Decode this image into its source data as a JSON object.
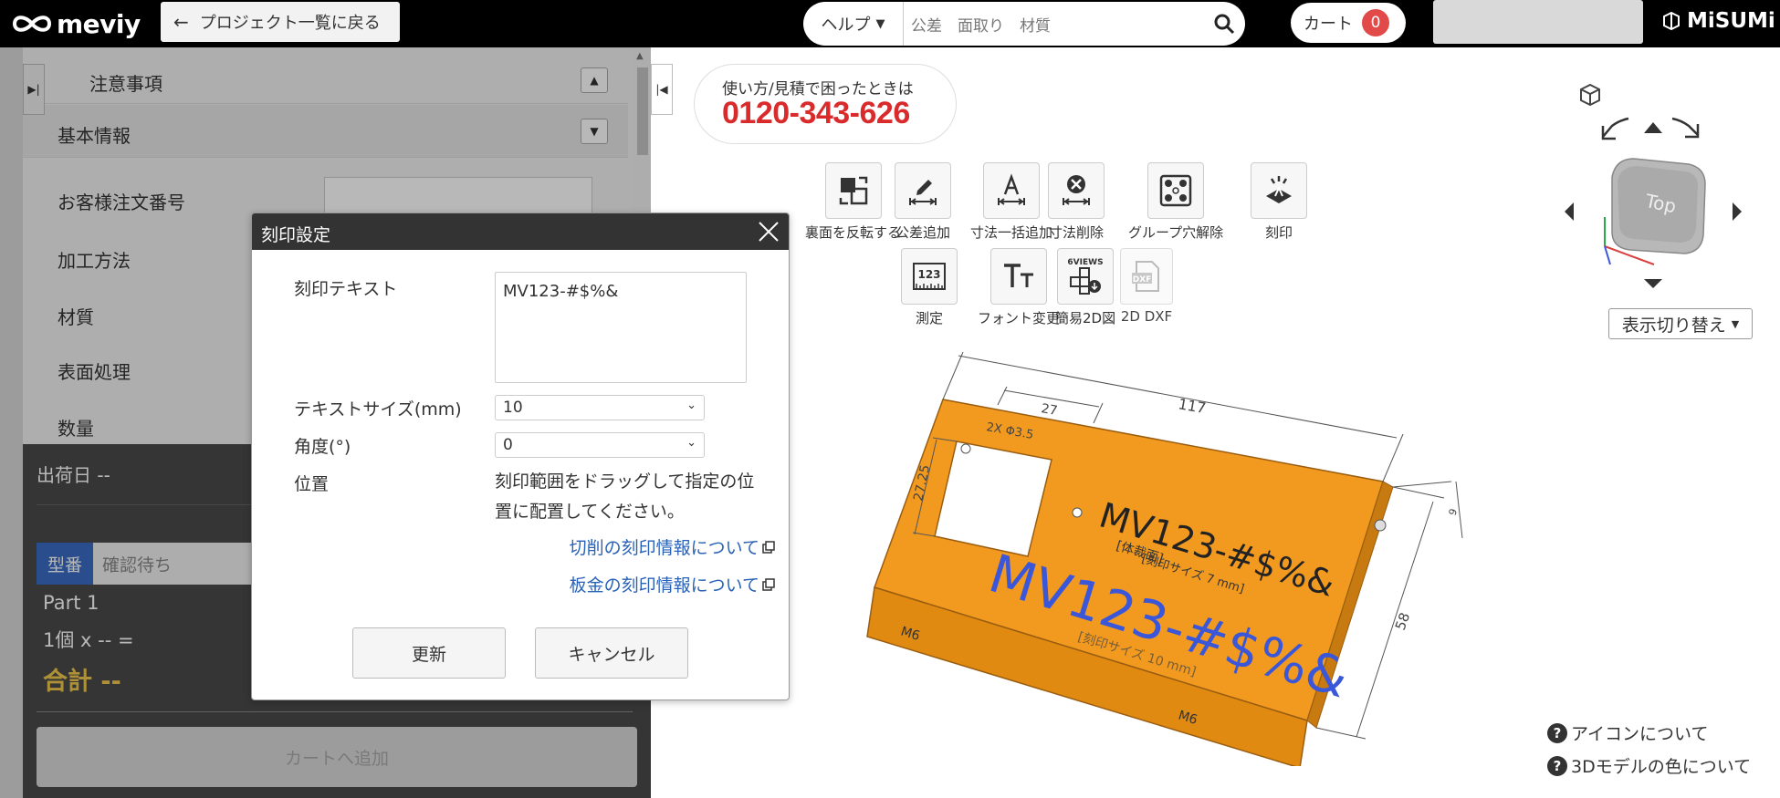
{
  "header": {
    "logo_text": "meviy",
    "back_label": "プロジェクト一覧に戻る",
    "help_label": "ヘルプ",
    "search_placeholder": "公差　面取り　材質",
    "cart_label": "カート",
    "cart_count": "0",
    "brand": "MiSUMi"
  },
  "left_panel": {
    "notes_label": "注意事項",
    "basic_info_label": "基本情報",
    "fields": [
      "お客様注文番号",
      "加工方法",
      "材質",
      "表面処理",
      "数量"
    ],
    "ship_date": "出荷日 --",
    "model_tag": "型番",
    "model_status": "確認待ち",
    "part_name": "Part 1",
    "qty_line": "1個  x -- =",
    "total": "合計 --",
    "add_to_cart": "カートへ追加"
  },
  "phone": {
    "note": "使い方/見積で困ったときは",
    "number": "0120-343-626"
  },
  "toolbar": {
    "row1": [
      "裏面を反転する",
      "公差追加",
      "寸法一括追加",
      "寸法削除",
      "グループ穴解除",
      "刻印"
    ],
    "row2": [
      "測定",
      "フォント変更",
      "簡易2D図",
      "2D DXF"
    ],
    "sixviews_badge": "6VIEWS",
    "dxf_badge": "DXF",
    "measure_badge": "123"
  },
  "viewcube": {
    "face_label": "Top",
    "toggle_label": "表示切り替え"
  },
  "model": {
    "dim_117": "117",
    "dim_27a": "27",
    "dim_27_25": "27.25",
    "dim_58": "58",
    "dim_9": "9",
    "tag_a": "2X Φ3.5",
    "tag_m6": "M6",
    "engrave_black": "MV123-#$%&",
    "engrave_blue": "MV123-#$%&",
    "engrave_note1": "[体裁面]",
    "engrave_note2": "[刻印サイズ 7 mm]",
    "engrave_note3": "[刻印サイズ 10 mm]"
  },
  "help_links": [
    "アイコンについて",
    "3Dモデルの色について"
  ],
  "dialog": {
    "title": "刻印設定",
    "text_label": "刻印テキスト",
    "text_value": "MV123-#$%&",
    "size_label": "テキストサイズ(mm)",
    "size_value": "10",
    "angle_label": "角度(°)",
    "angle_value": "0",
    "position_label": "位置",
    "position_help": "刻印範囲をドラッグして指定の位置に配置してください。",
    "link_cutting": "切削の刻印情報について",
    "link_sheet": "板金の刻印情報について",
    "update_button": "更新",
    "cancel_button": "キャンセル"
  },
  "colors": {
    "model_orange": "#f29a1f",
    "engrave_blue": "#3b57d9",
    "phone_red": "#d92b2b",
    "badge_red": "#e24a4a",
    "link_blue": "#2a62b8",
    "total_yellow": "#f2c94c"
  }
}
